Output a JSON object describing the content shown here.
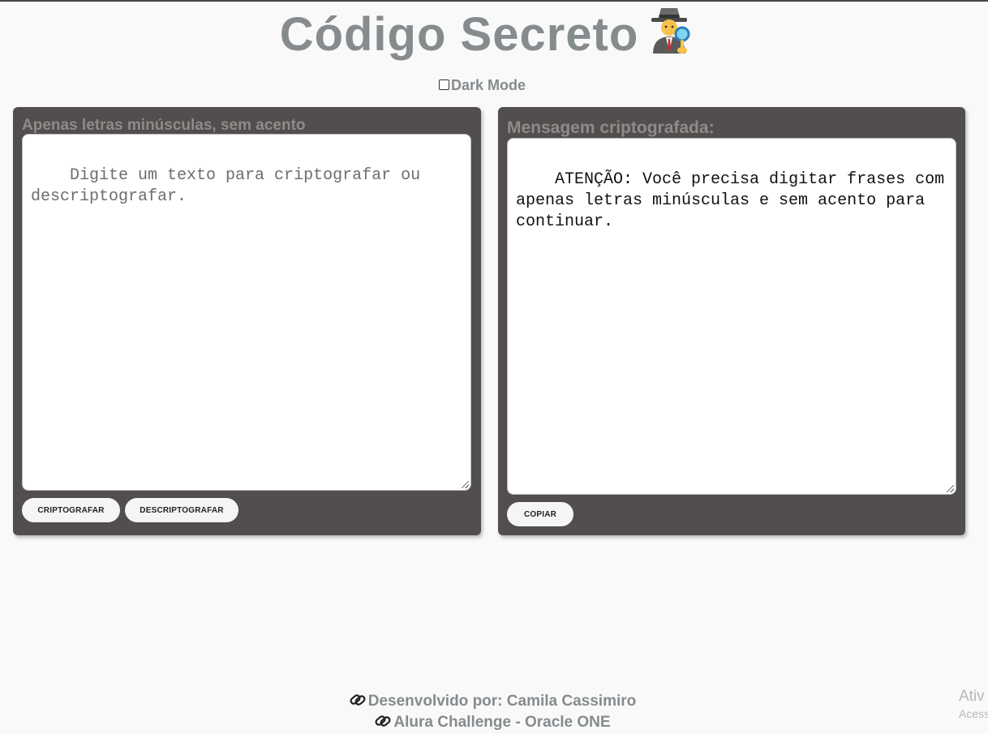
{
  "header": {
    "title": "Código Secreto",
    "title_icon": "detective-icon"
  },
  "dark_mode": {
    "label": "Dark Mode",
    "checked": false
  },
  "encrypt_panel": {
    "label": "Apenas letras minúsculas, sem acento",
    "textarea_placeholder": "Digite um texto para criptografar ou descriptografar.",
    "encrypt_button": "CRIPTOGRAFAR",
    "decrypt_button": "DESCRIPTOGRAFAR"
  },
  "result_panel": {
    "label": "Mensagem criptografada:",
    "textarea_value": "ATENÇÃO: Você precisa digitar frases com apenas letras minúsculas e sem acento para continuar.",
    "copy_button": "COPIAR"
  },
  "footer": {
    "developer_link": "Desenvolvido por: Camila Cassimiro",
    "challenge_link": "Alura Challenge - Oracle ONE",
    "link_icon": "link-icon"
  },
  "os_watermark": {
    "line1": "Ativ",
    "line2": "Acess"
  },
  "colors": {
    "background": "#f9f9f9",
    "panel": "#524e4d",
    "title_text": "#868b8e",
    "button_bg": "#f5f5f5"
  }
}
